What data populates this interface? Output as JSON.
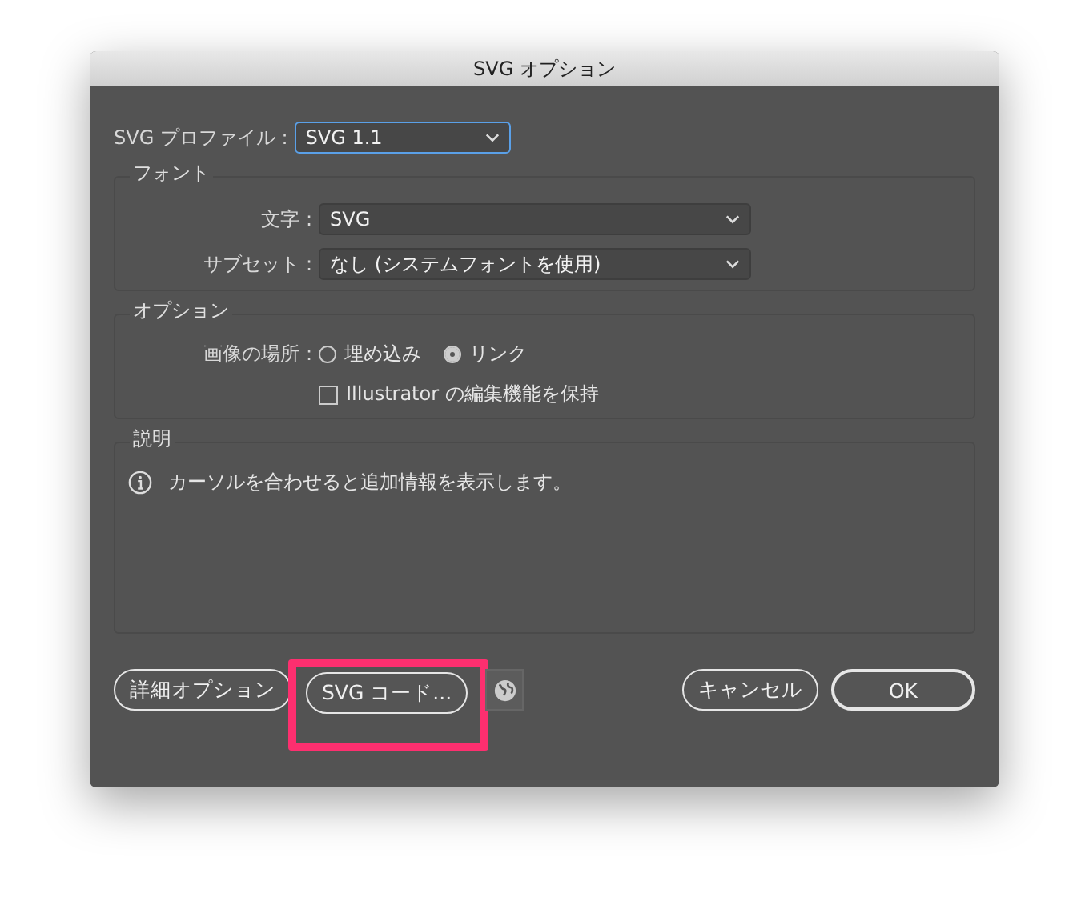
{
  "window": {
    "title": "SVG オプション"
  },
  "profile": {
    "label": "SVG プロファイル :",
    "value": "SVG 1.1",
    "focused": true
  },
  "font_group": {
    "title": "フォント",
    "fields": [
      {
        "label": "文字 :",
        "value": "SVG"
      },
      {
        "label": "サブセット :",
        "value": "なし (システムフォントを使用)"
      }
    ]
  },
  "options_group": {
    "title": "オプション",
    "image_location": {
      "label": "画像の場所 :",
      "options": [
        {
          "label": "埋め込み",
          "selected": false
        },
        {
          "label": "リンク",
          "selected": true
        }
      ]
    },
    "preserve": {
      "label": "Illustrator の編集機能を保持",
      "checked": false
    }
  },
  "description": {
    "title": "説明",
    "text": "カーソルを合わせると追加情報を表示します。"
  },
  "buttons": [
    {
      "label": "詳細オプション",
      "kind": "plain"
    },
    {
      "label": "SVG コード...",
      "kind": "plain",
      "highlighted": true
    },
    {
      "kind": "globe"
    },
    {
      "kind": "spacer"
    },
    {
      "label": "キャンセル",
      "kind": "plain"
    },
    {
      "label": "OK",
      "kind": "default"
    }
  ]
}
